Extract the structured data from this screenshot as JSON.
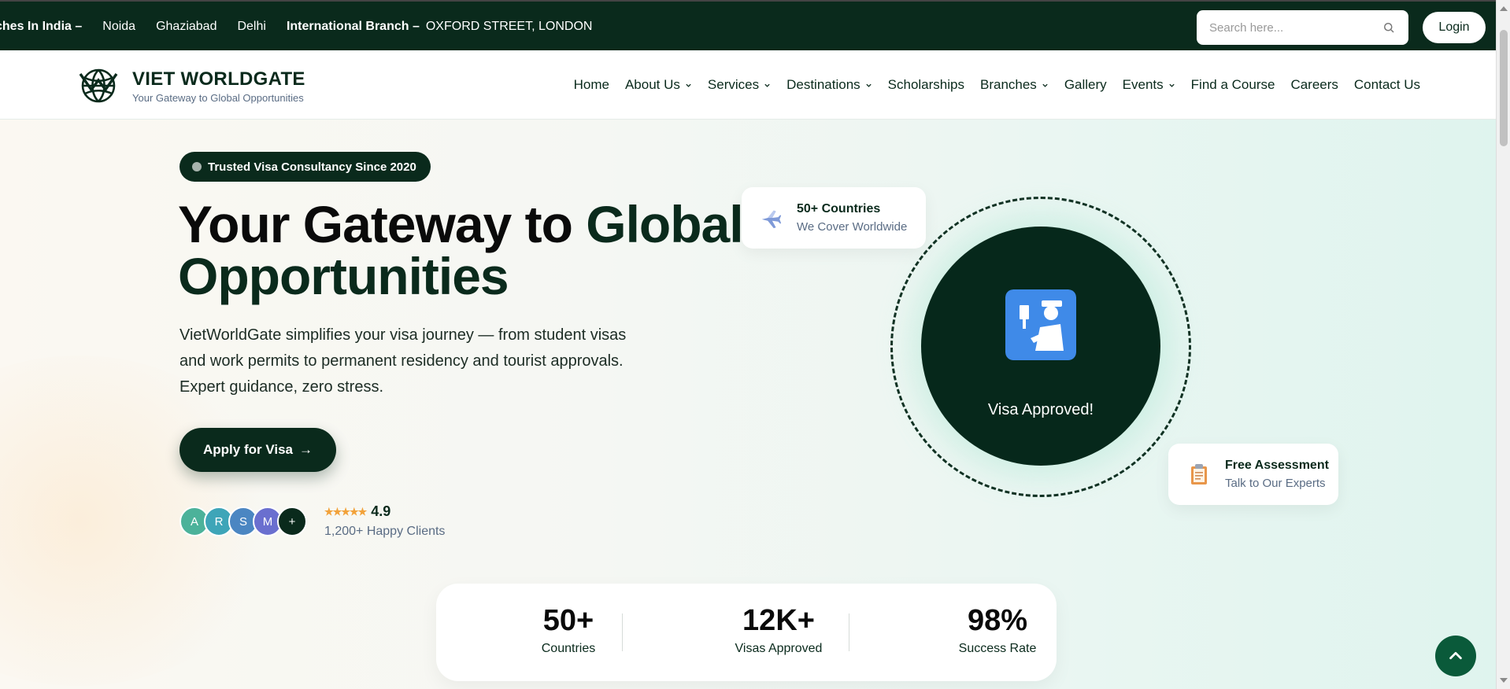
{
  "topbar": {
    "ticker": [
      {
        "text": "ches In India –",
        "bold": true
      },
      {
        "text": "Noida",
        "bold": false
      },
      {
        "text": "Ghaziabad",
        "bold": false
      },
      {
        "text": "Delhi",
        "bold": false
      },
      {
        "text": "International Branch –",
        "bold": true
      },
      {
        "text": "OXFORD STREET, LONDON",
        "bold": false
      }
    ],
    "search_placeholder": "Search here...",
    "login_label": "Login"
  },
  "brand": {
    "name": "VIET WORLDGATE",
    "tagline": "Your Gateway to Global Opportunities"
  },
  "nav": {
    "items": [
      {
        "label": "Home",
        "dropdown": false
      },
      {
        "label": "About Us",
        "dropdown": true
      },
      {
        "label": "Services",
        "dropdown": true
      },
      {
        "label": "Destinations",
        "dropdown": true
      },
      {
        "label": "Scholarships",
        "dropdown": false
      },
      {
        "label": "Branches",
        "dropdown": true
      },
      {
        "label": "Gallery",
        "dropdown": false
      },
      {
        "label": "Events",
        "dropdown": true
      },
      {
        "label": "Find a Course",
        "dropdown": false
      },
      {
        "label": "Careers",
        "dropdown": false
      },
      {
        "label": "Contact Us",
        "dropdown": false
      }
    ]
  },
  "hero": {
    "badge": "Trusted Visa Consultancy Since 2020",
    "headline_part1": "Your Gateway to ",
    "headline_accent": "Global",
    "headline_part2": "Opportunities",
    "lead": "VietWorldGate simplifies your visa journey — from student visas and work permits to permanent residency and tourist approvals. Expert guidance, zero stress.",
    "apply_label": "Apply for Visa",
    "apply_arrow": "→",
    "avatars": [
      {
        "letter": "A",
        "color": "#4cb29a"
      },
      {
        "letter": "R",
        "color": "#3ea5b8"
      },
      {
        "letter": "S",
        "color": "#4b86c2"
      },
      {
        "letter": "M",
        "color": "#6a6fcf"
      },
      {
        "letter": "+",
        "color": "#0a2a1c"
      }
    ],
    "stars": "★★★★★",
    "rating": "4.9",
    "clients": "1,200+ Happy Clients"
  },
  "cards": {
    "countries_title": "50+ Countries",
    "countries_sub": "We Cover Worldwide",
    "assess_title": "Free Assessment",
    "assess_sub": "Talk to Our Experts",
    "visa_text": "Visa Approved!"
  },
  "stats": [
    {
      "num": "50+",
      "label": "Countries"
    },
    {
      "num": "12K+",
      "label": "Visas Approved"
    },
    {
      "num": "98%",
      "label": "Success Rate"
    }
  ],
  "colors": {
    "brand_dark": "#0a2a1c",
    "star": "#f2a23a",
    "visa_blue": "#3f8ae8"
  }
}
